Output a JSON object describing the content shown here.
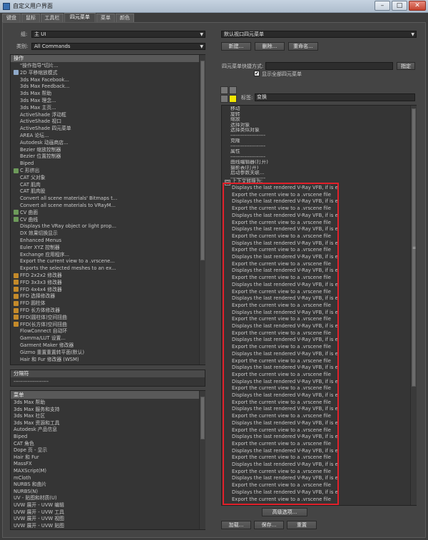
{
  "window": {
    "title": "自定义用户界面",
    "min_glyph": "–",
    "max_glyph": "□",
    "close_glyph": "✕"
  },
  "tabs": [
    {
      "label": "键盘"
    },
    {
      "label": "鼠标"
    },
    {
      "label": "工具栏"
    },
    {
      "label": "四元菜单"
    },
    {
      "label": "菜单"
    },
    {
      "label": "颜色"
    }
  ],
  "left": {
    "group_label": "组:",
    "group_value": "主 UI",
    "category_label": "类别:",
    "category_value": "All Commands",
    "actions_header": "操作",
    "actions": [
      "\"操作指导\"切片...",
      "2D 平移缩放模式",
      "3ds Max Facebook...",
      "3ds Max Feedback...",
      "3ds Max 帮助",
      "3ds Max 理念...",
      "3ds Max 主页...",
      "ActiveShade 浮动框",
      "ActiveShade 视口",
      "ActiveShade 四元菜单",
      "AREA 论坛...",
      "Autodesk 动画商店...",
      "Bezier 缩放控制器",
      "Bezier 位置控制器",
      "Biped",
      "C 形挤出",
      "CAT 父对象",
      "CAT 肌肉",
      "CAT 肌肉股",
      "Convert all scene materials' Bitmaps t...",
      "Convert all scene materials to VRayM...",
      "CV 曲面",
      "CV 曲线",
      "Displays the VRay object or light prop...",
      "DX 效果切换显示",
      "Enhanced Menus",
      "Euler XYZ 控制器",
      "Exchange 应用程序...",
      "Export the current view to a .vrscene...",
      "Exports the selected meshes to an ex...",
      "FFD 2x2x2 修改器",
      "FFD 3x3x3 修改器",
      "FFD 4x4x4 修改器",
      "FFD 选择修改器",
      "FFD 圆柱体",
      "FFD 长方体修改器",
      "FFD(圆柱体)空间扭曲",
      "FFD(长方体)空间扭曲",
      "FlowConnect 自动环",
      "Gamma/LUT 设置...",
      "Garment Maker 修改器",
      "Gizmo 重置重置转平面(默认)",
      "Hair 和 Fur 修改器 (WSM)"
    ],
    "separator_header": "分隔符",
    "separator_item": "--------------------",
    "menus_header": "菜单",
    "menus": [
      "3ds Max 帮助",
      "3ds Max 服务和支持",
      "3ds Max 社区",
      "3ds Max 资源和工具",
      "Autodesk 产品信息",
      "Biped",
      "CAT 角色",
      "Dope 页 - 显示",
      "Hair 和 Fur",
      "MassFX",
      "MAXScript(M)",
      "mCloth",
      "NURBS 和曲片",
      "NURBS(N)",
      "UV - 贴图和材质(U)",
      "UVW 展开 - UVW 编辑",
      "UVW 展开 - UVW 工具",
      "UVW 展开 - UVW 视图",
      "UVW 展开 - UVW 贴图"
    ]
  },
  "right": {
    "quad_select_value": "默认视口四元菜单",
    "btn_new": "新建...",
    "btn_delete": "删除...",
    "btn_rename": "重命名...",
    "shortcut_label": "四元菜单快捷方式:",
    "shortcut_value": "",
    "btn_assign": "指定",
    "show_all_label": "显示全部四元菜单",
    "show_all_checked": true,
    "quad_label_caption": "标签:",
    "quad_label_value": "变换",
    "quad_items": [
      {
        "t": "移动"
      },
      {
        "t": "旋转"
      },
      {
        "t": "缩放"
      },
      {
        "t": "选择对象"
      },
      {
        "t": "选择类似对象"
      },
      {
        "t": "--------------------"
      },
      {
        "t": "克隆"
      },
      {
        "t": "--------------------"
      },
      {
        "t": "属性"
      },
      {
        "t": "--------------------"
      },
      {
        "t": "曲线编辑器(打开)"
      },
      {
        "t": "摄影表(打开)"
      },
      {
        "t": "启动参数关联..."
      },
      {
        "t": "--------------------"
      }
    ],
    "context_submenu": "上下文转换为:",
    "vray_items": [
      "Displays the last rendered V-Ray VFB, if is exists",
      "Export the current view to a .vrscene file",
      "Displays the last rendered V-Ray VFB, if is exists",
      "Export the current view to a .vrscene file",
      "Displays the last rendered V-Ray VFB, if is exists",
      "Export the current view to a .vrscene file",
      "Displays the last rendered V-Ray VFB, if is exists",
      "Export the current view to a .vrscene file",
      "Displays the last rendered V-Ray VFB, if is exists",
      "Export the current view to a .vrscene file",
      "Displays the last rendered V-Ray VFB, if is exists",
      "Export the current view to a .vrscene file",
      "Displays the last rendered V-Ray VFB, if is exists",
      "Export the current view to a .vrscene file",
      "Displays the last rendered V-Ray VFB, if is exists",
      "Export the current view to a .vrscene file",
      "Displays the last rendered V-Ray VFB, if is exists",
      "Export the current view to a .vrscene file",
      "Displays the last rendered V-Ray VFB, if is exists",
      "Export the current view to a .vrscene file",
      "Displays the last rendered V-Ray VFB, if is exists",
      "Export the current view to a .vrscene file",
      "Displays the last rendered V-Ray VFB, if is exists",
      "Export the current view to a .vrscene file",
      "Displays the last rendered V-Ray VFB, if is exists",
      "Export the current view to a .vrscene file",
      "Displays the last rendered V-Ray VFB, if is exists",
      "Export the current view to a .vrscene file",
      "Displays the last rendered V-Ray VFB, if is exists",
      "Export the current view to a .vrscene file",
      "Displays the last rendered V-Ray VFB, if is exists",
      "Export the current view to a .vrscene file",
      "Displays the last rendered V-Ray VFB, if is exists",
      "Export the current view to a .vrscene file",
      "Displays the last rendered V-Ray VFB, if is exists",
      "Export the current view to a .vrscene file",
      "Displays the last rendered V-Ray VFB, if is exists",
      "Export the current view to a .vrscene file",
      "Displays the last rendered V-Ray VFB, if is exists",
      "Export the current view to a .vrscene file",
      "Displays the last rendered V-Ray VFB, if is exists",
      "Export the current view to a .vrscene file",
      "Displays the last rendered V-Ray VFB, if is exists",
      "Export the current view to a .vrscene file",
      "Displays the last rendered V-Ray VFB, if is exists",
      "Export the current view to a .vrscene file"
    ],
    "btn_advanced": "高级选项...",
    "btn_load": "加载...",
    "btn_save": "保存...",
    "btn_reset": "重置"
  },
  "colors": {
    "highlight_box": "#e2202a",
    "quad_selected": "#f2e600"
  }
}
